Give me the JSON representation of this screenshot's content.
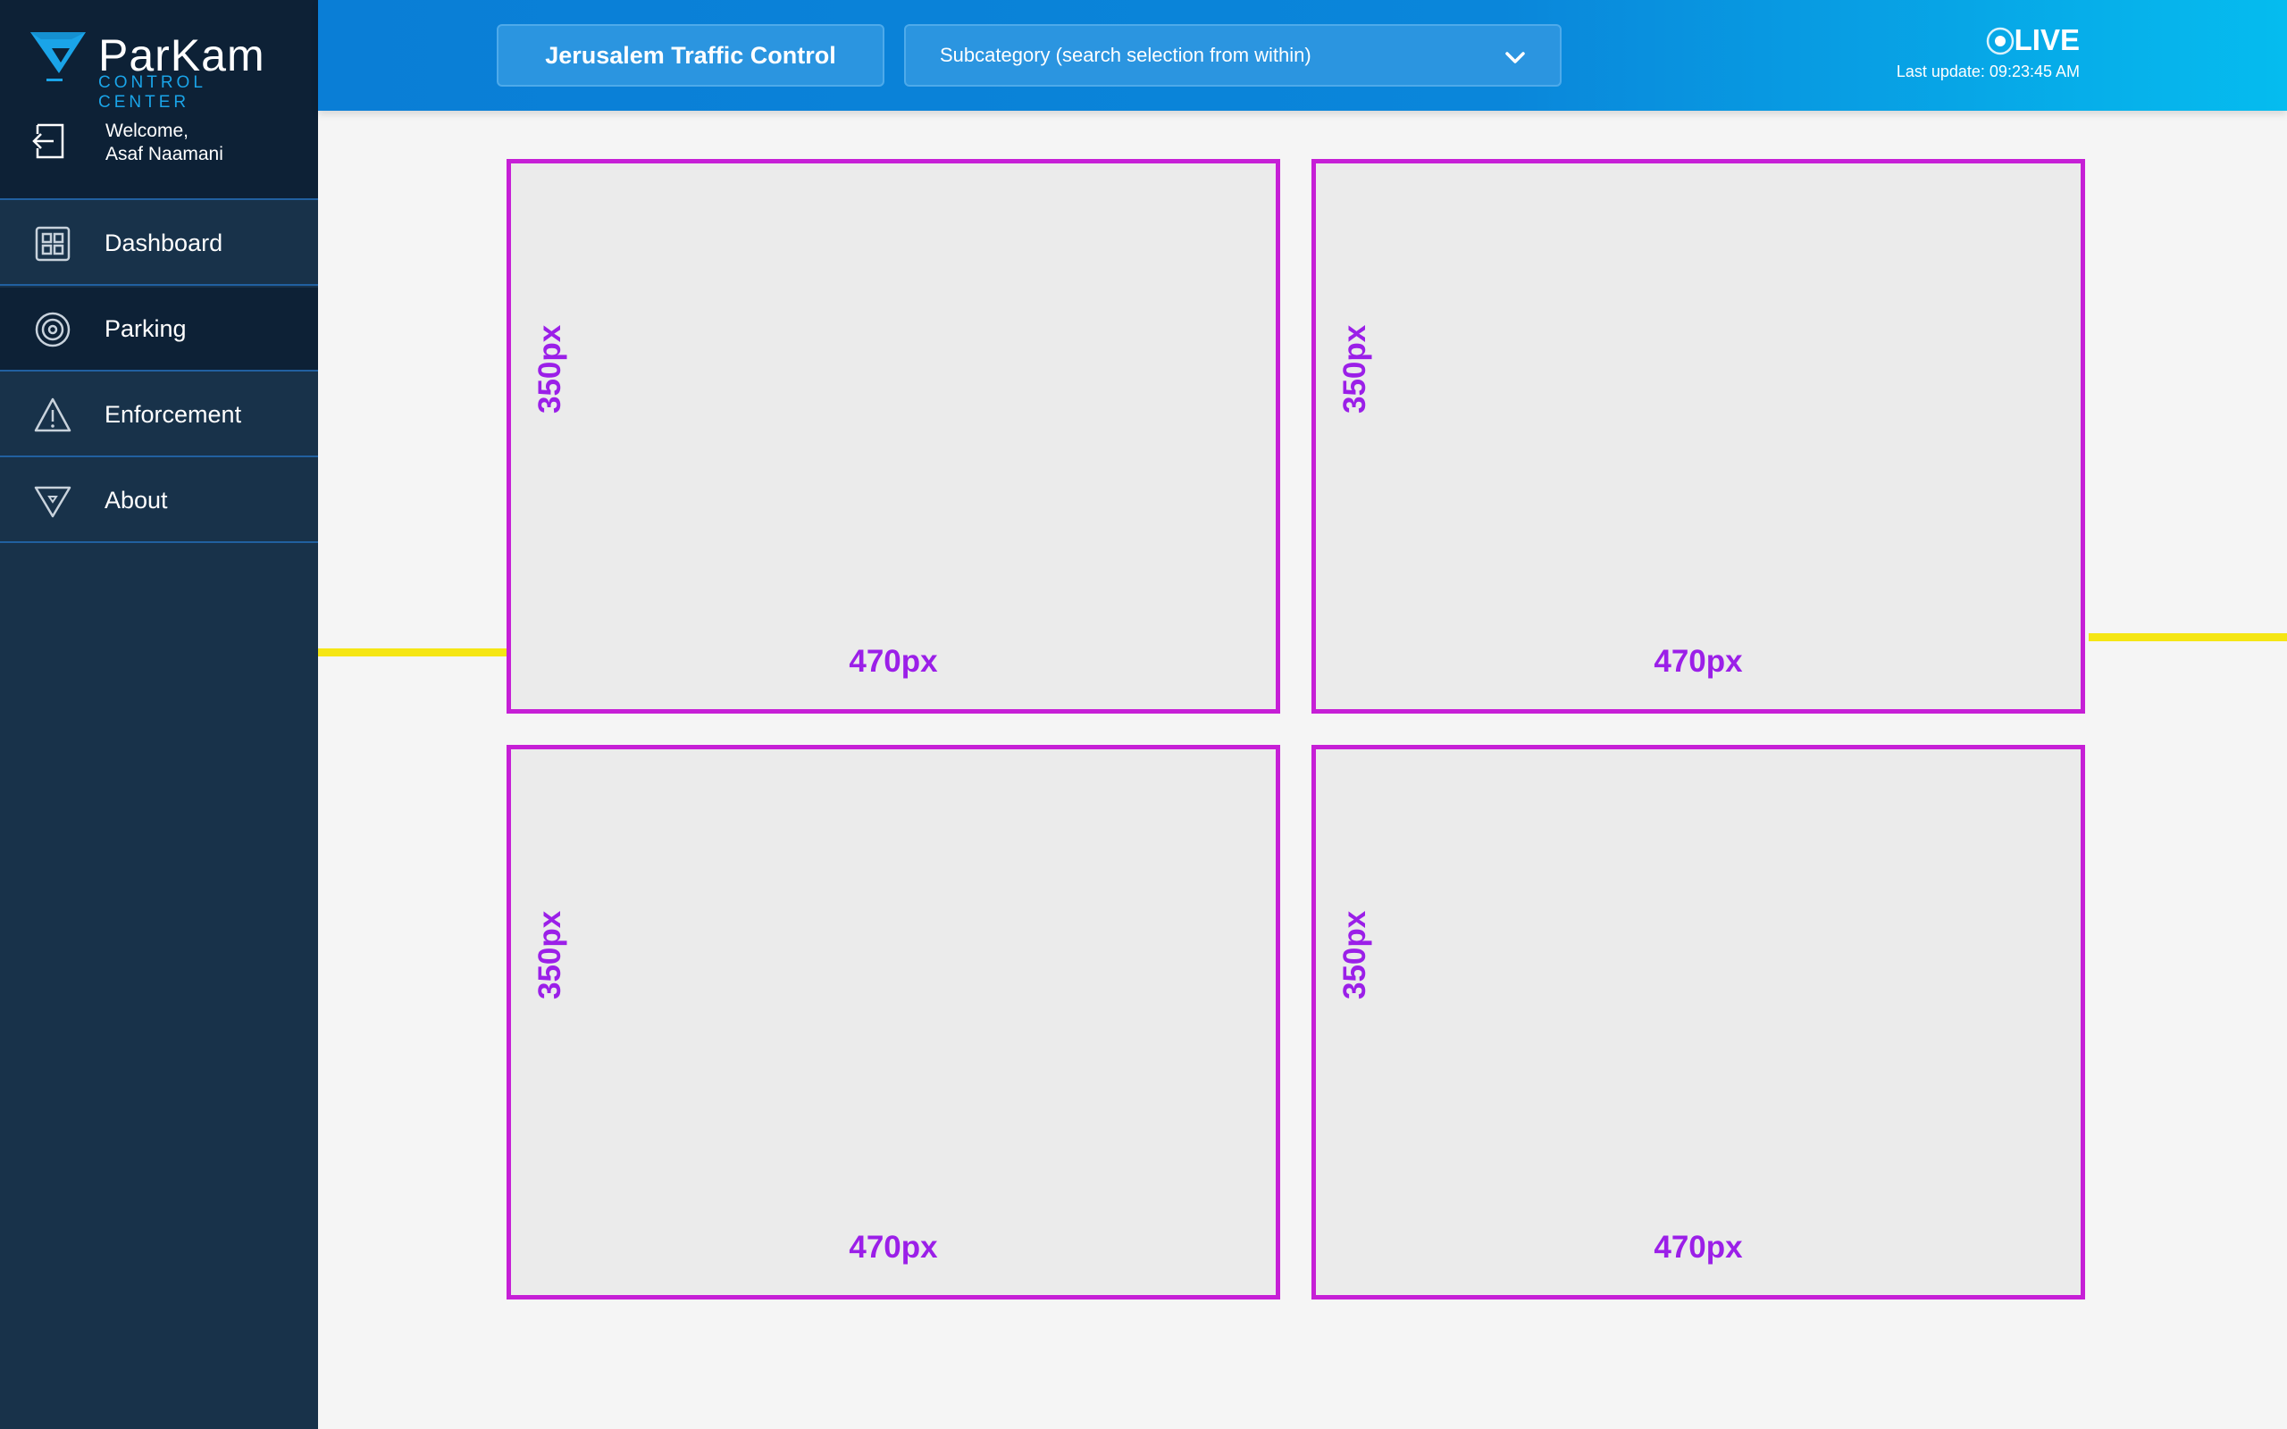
{
  "app": {
    "logo_name": "ParKam",
    "logo_subtitle": "CONTROL CENTER"
  },
  "user": {
    "greeting": "Welcome,",
    "name": "Asaf Naamani",
    "logout_icon": "logout-icon"
  },
  "nav": [
    {
      "label": "Dashboard",
      "icon": "dashboard-grid-icon"
    },
    {
      "label": "Parking",
      "icon": "target-icon",
      "active": true
    },
    {
      "label": "Enforcement",
      "icon": "warning-icon"
    },
    {
      "label": "About",
      "icon": "logo-shield-icon"
    }
  ],
  "header": {
    "category_label": "Jerusalem Traffic Control",
    "subcategory_placeholder": "Subcategory (search selection from within)",
    "live_label": "LIVE",
    "last_update": "Last update:  09:23:45 AM"
  },
  "panels": [
    {
      "width_label": "470px",
      "height_label": "350px"
    },
    {
      "width_label": "470px",
      "height_label": "350px"
    },
    {
      "width_label": "470px",
      "height_label": "350px"
    },
    {
      "width_label": "470px",
      "height_label": "350px"
    }
  ],
  "colors": {
    "sidebar": "#18324a",
    "sidebar_dark": "#0d2136",
    "header_blue": "#0a7ed6",
    "panel_border": "#c61fd6",
    "dimension_text": "#9b1fe8",
    "guide_line": "#f5e614"
  }
}
